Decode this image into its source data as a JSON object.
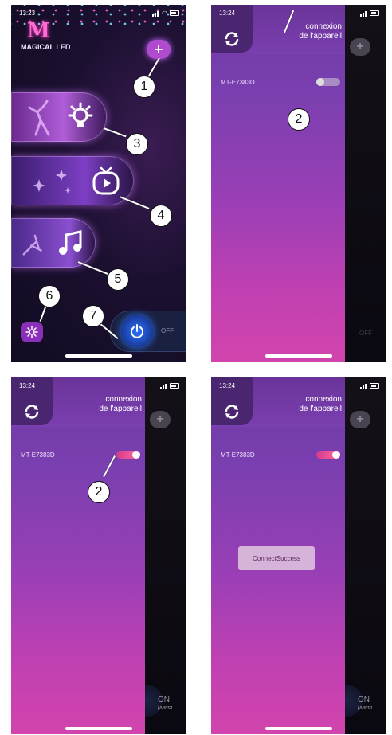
{
  "screens": [
    {
      "status_time": "13:23",
      "app_name": "MAGICAL LED",
      "logo_letter": "M",
      "add_icon": "plus-icon",
      "menu": [
        {
          "name": "light",
          "icon": "bulb-icon"
        },
        {
          "name": "scene",
          "icon": "tv-play-icon"
        },
        {
          "name": "music",
          "icon": "music-note-icon"
        }
      ],
      "settings_icon": "gear-icon",
      "power_icon": "power-icon",
      "power_state": "OFF"
    },
    {
      "status_time": "13:24",
      "title_line1": "connexion",
      "title_line2": "de l'appareil",
      "device_name": "MT-E7383D",
      "toggle_on": false,
      "power_state": "OFF"
    },
    {
      "status_time": "13:24",
      "title_line1": "connexion",
      "title_line2": "de l'appareil",
      "device_name": "MT-E7383D",
      "toggle_on": true,
      "power_state": "ON",
      "power_sub": "power"
    },
    {
      "status_time": "13:24",
      "title_line1": "connexion",
      "title_line2": "de l'appareil",
      "device_name": "MT-E7383D",
      "toggle_on": true,
      "toast": "ConnectSuccess",
      "power_state": "ON",
      "power_sub": "power"
    }
  ],
  "callouts": [
    "1",
    "2",
    "3",
    "4",
    "5",
    "6",
    "7"
  ],
  "colors": {
    "accent_pink": "#ff6ad5",
    "panel_purple": "#7a3fb0",
    "power_blue": "#2a72ff"
  }
}
